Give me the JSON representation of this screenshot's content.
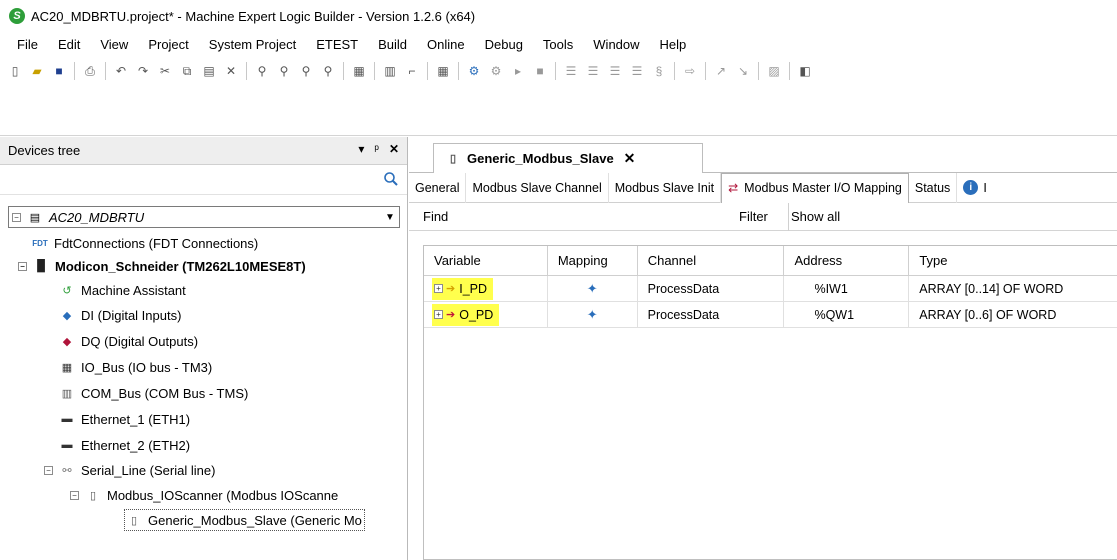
{
  "window": {
    "title": "AC20_MDBRTU.project* - Machine Expert Logic Builder - Version 1.2.6 (x64)"
  },
  "menu": [
    "File",
    "Edit",
    "View",
    "Project",
    "System Project",
    "ETEST",
    "Build",
    "Online",
    "Debug",
    "Tools",
    "Window",
    "Help"
  ],
  "toolbar_icons": [
    "new-icon",
    "open-icon",
    "save-icon",
    "print-icon",
    "undo-icon",
    "redo-icon",
    "cut-icon",
    "copy-icon",
    "paste-icon",
    "delete-icon",
    "find-icon",
    "find-next-icon",
    "find-replace-icon",
    "replace-icon",
    "device-icon",
    "add-device-icon",
    "insert-icon",
    "login-icon",
    "connect-icon",
    "disconnect-icon",
    "run-icon",
    "stop-icon",
    "breakpoint-icon",
    "step-over-icon",
    "step-into-icon",
    "step-out-icon",
    "flow-icon",
    "arrow-icon",
    "write-icon",
    "force-icon",
    "unforce-icon",
    "help-icon"
  ],
  "devices": {
    "panel_title": "Devices tree",
    "search_placeholder": "",
    "root": "AC20_MDBRTU",
    "nodes": [
      {
        "label": "FdtConnections (FDT Connections)",
        "icon": "fdt-icon",
        "bold": false
      },
      {
        "label": "Modicon_Schneider (TM262L10MESE8T)",
        "icon": "plc-icon",
        "bold": true
      },
      {
        "label": "Machine Assistant",
        "icon": "assistant-icon",
        "bold": false
      },
      {
        "label": "DI (Digital Inputs)",
        "icon": "digital-input-icon",
        "bold": false
      },
      {
        "label": "DQ (Digital Outputs)",
        "icon": "digital-output-icon",
        "bold": false
      },
      {
        "label": "IO_Bus (IO bus - TM3)",
        "icon": "io-bus-icon",
        "bold": false
      },
      {
        "label": "COM_Bus (COM Bus - TMS)",
        "icon": "com-bus-icon",
        "bold": false
      },
      {
        "label": "Ethernet_1 (ETH1)",
        "icon": "ethernet-icon",
        "bold": false
      },
      {
        "label": "Ethernet_2 (ETH2)",
        "icon": "ethernet-icon",
        "bold": false
      },
      {
        "label": "Serial_Line (Serial line)",
        "icon": "serial-line-icon",
        "bold": false
      },
      {
        "label": "Modbus_IOScanner (Modbus IOScanne",
        "icon": "module-icon",
        "bold": false
      },
      {
        "label": "Generic_Modbus_Slave (Generic Mo",
        "icon": "module-icon",
        "bold": false
      }
    ]
  },
  "editor": {
    "doc_tab": "Generic_Modbus_Slave",
    "tabs": [
      "General",
      "Modbus Slave Channel",
      "Modbus Slave Init",
      "Modbus Master I/O Mapping",
      "Status",
      "I"
    ],
    "find_label": "Find",
    "filter_label": "Filter",
    "filter_value": "Show all",
    "columns": [
      "Variable",
      "Mapping",
      "Channel",
      "Address",
      "Type"
    ],
    "rows": [
      {
        "variable": "I_PD",
        "channel": "ProcessData",
        "address": "%IW1",
        "type": "ARRAY [0..14] OF WORD"
      },
      {
        "variable": "O_PD",
        "channel": "ProcessData",
        "address": "%QW1",
        "type": "ARRAY [0..6] OF WORD"
      }
    ]
  },
  "colors": {
    "highlight": "#ffff4d",
    "accent_green": "#2e9e3a"
  }
}
